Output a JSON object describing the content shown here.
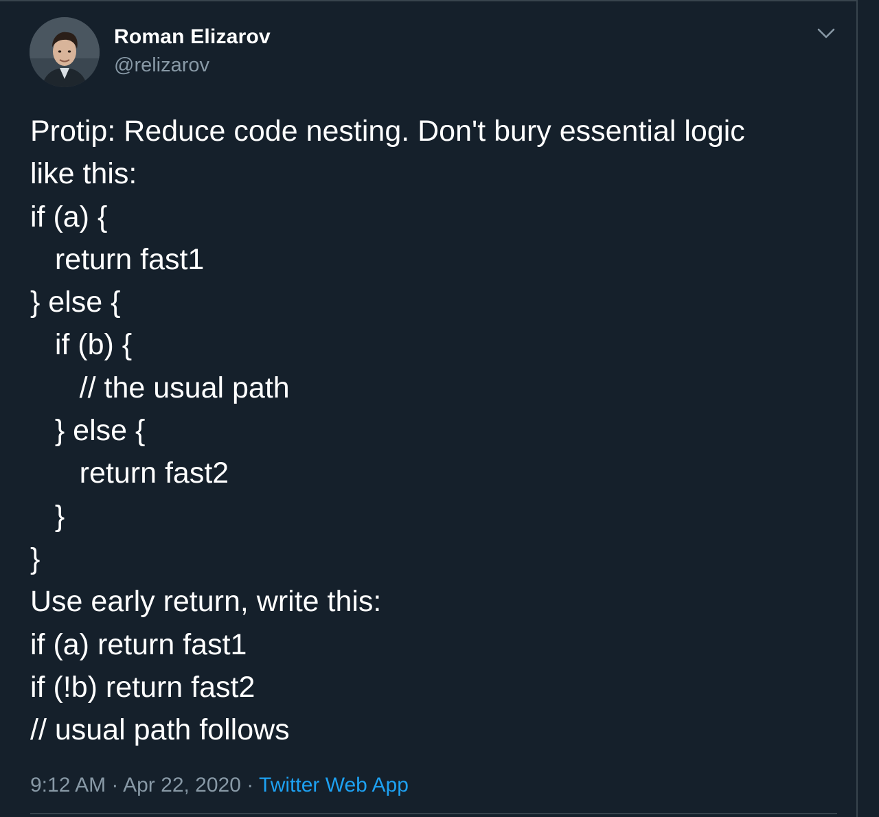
{
  "tweet": {
    "author_name": "Roman Elizarov",
    "author_handle": "@relizarov",
    "avatar_icon": "profile-photo",
    "menu_icon": "chevron-down-icon",
    "lines": [
      "Protip: Reduce code nesting. Don't bury essential logic",
      "like this:",
      "if (a) {",
      "   return fast1",
      "} else {",
      "   if (b) {",
      "      // the usual path",
      "   } else {",
      "      return fast2",
      "   }",
      "}",
      "Use early return, write this:",
      "if (a) return fast1",
      "if (!b) return fast2",
      "// usual path follows"
    ],
    "time": "9:12 AM",
    "separator": "·",
    "date": "Apr 22, 2020",
    "source": "Twitter Web App"
  },
  "colors": {
    "background": "#15202b",
    "text_primary": "#ffffff",
    "text_secondary": "#8899a6",
    "link": "#1da1f2",
    "border": "#38444d"
  }
}
